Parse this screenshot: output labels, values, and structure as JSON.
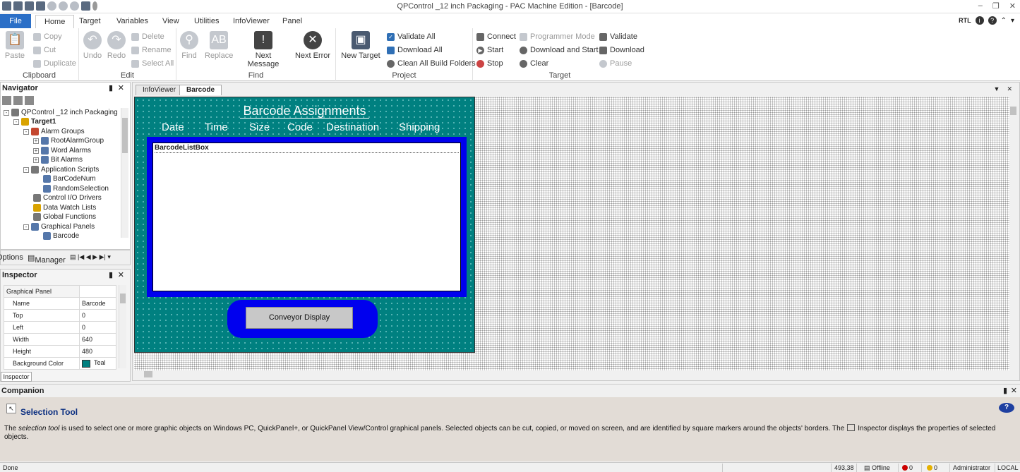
{
  "window": {
    "title": "QPControl _12 inch Packaging - PAC Machine Edition - [Barcode]"
  },
  "menu": {
    "tabs": [
      "File",
      "Home",
      "Target",
      "Variables",
      "View",
      "Utilities",
      "InfoViewer",
      "Panel"
    ],
    "right_label": "RTL"
  },
  "ribbon": {
    "clipboard": {
      "label": "Clipboard",
      "paste": "Paste",
      "copy": "Copy",
      "cut": "Cut",
      "duplicate": "Duplicate"
    },
    "edit": {
      "label": "Edit",
      "undo": "Undo",
      "redo": "Redo",
      "delete": "Delete",
      "rename": "Rename",
      "select_all": "Select All"
    },
    "find": {
      "label": "Find",
      "find": "Find",
      "replace": "Replace",
      "next_message": "Next Message",
      "next_error": "Next Error"
    },
    "project": {
      "label": "Project",
      "new_target": "New Target",
      "validate_all": "Validate All",
      "download_all": "Download All",
      "clean_all": "Clean All Build Folders"
    },
    "target": {
      "label": "Target",
      "connect": "Connect",
      "start": "Start",
      "stop": "Stop",
      "programmer_mode": "Programmer Mode",
      "download_and_start": "Download and Start",
      "clear": "Clear",
      "validate": "Validate",
      "download": "Download",
      "pause": "Pause"
    }
  },
  "navigator": {
    "title": "Navigator",
    "tree": [
      {
        "label": "QPControl _12 inch Packaging",
        "level": 0,
        "bold": false
      },
      {
        "label": "Target1",
        "level": 1,
        "bold": true
      },
      {
        "label": "Alarm Groups",
        "level": 2,
        "bold": false
      },
      {
        "label": "RootAlarmGroup",
        "level": 3,
        "bold": false
      },
      {
        "label": "Word Alarms",
        "level": 3,
        "bold": false
      },
      {
        "label": "Bit Alarms",
        "level": 3,
        "bold": false
      },
      {
        "label": "Application Scripts",
        "level": 2,
        "bold": false
      },
      {
        "label": "BarCodeNum",
        "level": 3,
        "bold": false
      },
      {
        "label": "RandomSelection",
        "level": 3,
        "bold": false
      },
      {
        "label": "Control I/O Drivers",
        "level": 2,
        "bold": false
      },
      {
        "label": "Data Watch Lists",
        "level": 2,
        "bold": false
      },
      {
        "label": "Global Functions",
        "level": 2,
        "bold": false
      },
      {
        "label": "Graphical Panels",
        "level": 2,
        "bold": false
      },
      {
        "label": "Barcode",
        "level": 3,
        "bold": false
      }
    ],
    "tabs": {
      "options": "Options",
      "manager": "Manager"
    }
  },
  "inspector": {
    "title": "Inspector",
    "section": "Graphical Panel",
    "props": [
      {
        "key": "Name",
        "value": "Barcode"
      },
      {
        "key": "Top",
        "value": "0"
      },
      {
        "key": "Left",
        "value": "0"
      },
      {
        "key": "Width",
        "value": "640"
      },
      {
        "key": "Height",
        "value": "480"
      },
      {
        "key": "Background Color",
        "value": "Teal"
      }
    ],
    "tab": "Inspector"
  },
  "document": {
    "tabs": [
      "InfoViewer",
      "Barcode"
    ],
    "active_tab": "Barcode",
    "panel": {
      "title": "Barcode Assignments",
      "columns": [
        "Date",
        "Time",
        "Size",
        "Code",
        "Destination",
        "Shipping"
      ],
      "listbox_label": "BarcodeListBox",
      "button_label": "Conveyor Display",
      "background_color": "#008080",
      "frame_color": "#0000ee"
    }
  },
  "companion": {
    "title": "Companion",
    "tool_title": "Selection Tool",
    "text_pre": "The ",
    "text_italic": "selection tool",
    "text_mid": " is used to select one or more graphic objects on Windows PC, QuickPanel+, or QuickPanel View/Control graphical panels. Selected objects can be cut, copied, or moved on screen, and are identified by square markers around the objects' borders. The",
    "text_post": "Inspector displays the properties of selected objects."
  },
  "status": {
    "left": "Done",
    "coords": "493,38",
    "connection": "Offline",
    "errors": "0",
    "warnings": "0",
    "user": "Administrator",
    "location": "LOCAL"
  }
}
